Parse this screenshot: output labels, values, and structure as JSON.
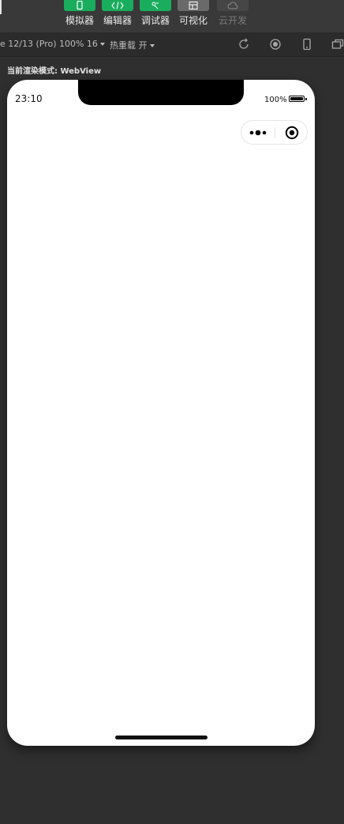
{
  "toolbar": {
    "tools": [
      {
        "label": "模拟器",
        "icon": "phone-icon",
        "state": "active"
      },
      {
        "label": "编辑器",
        "icon": "code-icon",
        "state": "active"
      },
      {
        "label": "调试器",
        "icon": "debug-icon",
        "state": "active"
      },
      {
        "label": "可视化",
        "icon": "layout-icon",
        "state": "inactive"
      },
      {
        "label": "云开发",
        "icon": "cloud-icon",
        "state": "disabled"
      }
    ],
    "accent_color": "#1aad5e"
  },
  "subbar": {
    "device": "e 12/13 (Pro) 100% 16",
    "hot_reload": "热重载 开",
    "icons": [
      "refresh-icon",
      "record-icon",
      "device-icon",
      "window-icon"
    ]
  },
  "render_mode": "当前渲染模式: WebView",
  "simulator": {
    "time": "23:10",
    "battery": "100%",
    "capsule_icons": [
      "more-icon",
      "close-icon"
    ]
  }
}
